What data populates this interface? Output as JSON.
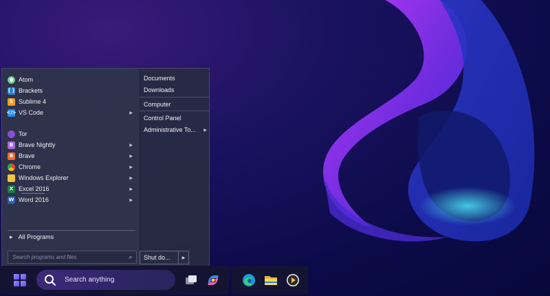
{
  "programs": [
    {
      "label": "Atom",
      "icon": "atom-icon",
      "color": "#6bd18a",
      "submenu": false
    },
    {
      "label": "Brackets",
      "icon": "brackets-icon",
      "color": "#2a7fd4",
      "submenu": false
    },
    {
      "label": "Sublime 4",
      "icon": "sublime-icon",
      "color": "#f59a23",
      "submenu": false
    },
    {
      "label": "VS Code",
      "icon": "vscode-icon",
      "color": "#2b8cf0",
      "submenu": true
    },
    {
      "label": "Tor",
      "icon": "tor-icon",
      "color": "#8a4fd6",
      "submenu": false
    },
    {
      "label": "Brave Nightly",
      "icon": "brave-nightly-icon",
      "color": "#a56ad8",
      "submenu": true
    },
    {
      "label": "Brave",
      "icon": "brave-icon",
      "color": "#f06a2a",
      "submenu": true
    },
    {
      "label": "Chrome",
      "icon": "chrome-icon",
      "color": "#e8b21a",
      "submenu": true
    },
    {
      "label": "Windows Explorer",
      "icon": "folder-icon",
      "color": "#f4c542",
      "submenu": true
    },
    {
      "label": "Excel 2016",
      "icon": "excel-icon",
      "color": "#1e7a45",
      "submenu": true
    },
    {
      "label": "Word 2016",
      "icon": "word-icon",
      "color": "#2a5fb5",
      "submenu": true
    }
  ],
  "all_programs": "All Programs",
  "search": {
    "placeholder": "Search programs and files"
  },
  "places": [
    {
      "label": "Documents",
      "submenu": false
    },
    {
      "label": "Downloads",
      "submenu": false
    },
    {
      "label": "Computer",
      "submenu": false
    },
    {
      "label": "Control Panel",
      "submenu": false
    },
    {
      "label": "Administrative To...",
      "submenu": true
    }
  ],
  "shutdown": {
    "label": "Shut do..."
  },
  "taskbar": {
    "search_text": "Search anything",
    "pinned": [
      "task-view-icon",
      "copilot-icon",
      "edge-icon",
      "file-explorer-icon",
      "media-player-icon"
    ]
  }
}
